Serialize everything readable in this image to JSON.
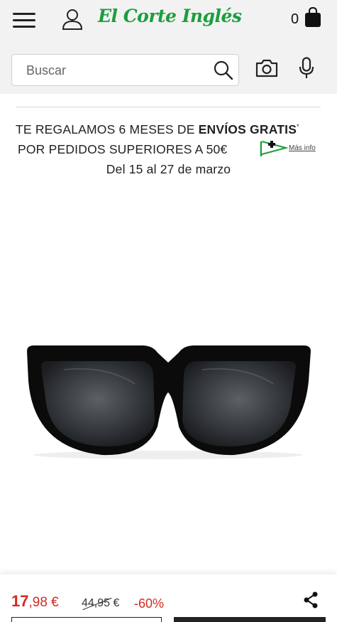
{
  "header": {
    "logo_text": "El Corte Inglés",
    "cart_count": "0",
    "brand_color": "#1b9e3e"
  },
  "search": {
    "placeholder": "Buscar"
  },
  "promo": {
    "line1_prefix": "TE REGALAMOS 6 MESES DE ",
    "line1_bold": "ENVÍOS GRATIS",
    "line1_mark": "*",
    "line2": "POR PEDIDOS SUPERIORES A 50€",
    "more_info": "Más info",
    "dates": "Del 15 al 27 de marzo"
  },
  "price": {
    "current_int": "17",
    "current_dec": ",98 €",
    "old": "44,95 €",
    "discount": "-60%",
    "accent_color": "#d22b22"
  },
  "icons": [
    "menu-icon",
    "user-icon",
    "bag-icon",
    "search-icon",
    "camera-icon",
    "microphone-icon",
    "flag-icon",
    "share-icon"
  ]
}
